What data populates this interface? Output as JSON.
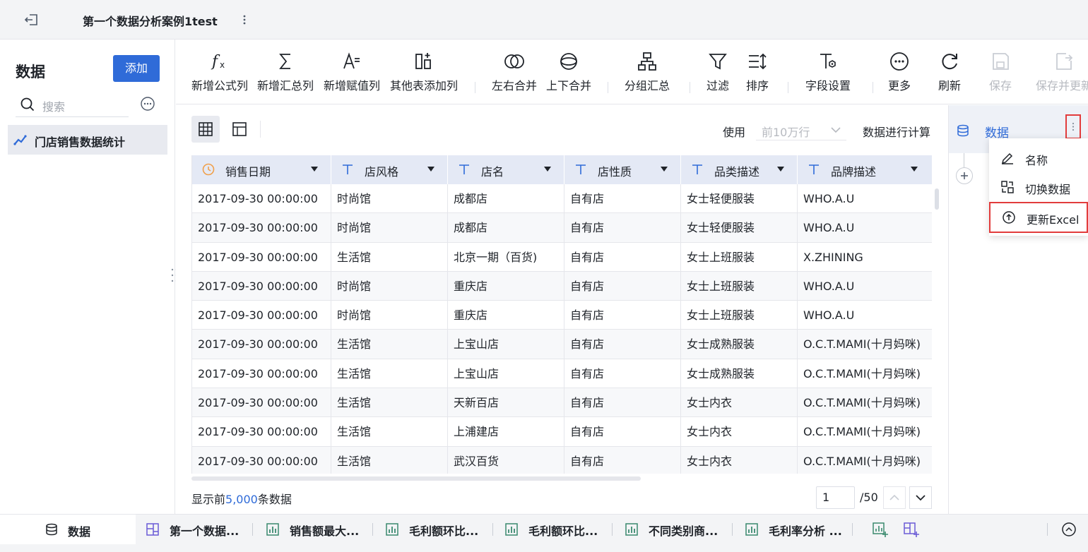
{
  "topbar": {
    "title": "第一个数据分析案例1test"
  },
  "left": {
    "title": "数据",
    "add_label": "添加",
    "search_placeholder": "搜索",
    "item_label": "门店销售数据统计"
  },
  "toolbar": {
    "items": [
      {
        "label": "新增公式列",
        "icon": "formula-icon"
      },
      {
        "label": "新增汇总列",
        "icon": "sigma-icon"
      },
      {
        "label": "新增赋值列",
        "icon": "assign-column-icon"
      },
      {
        "label": "其他表添加列",
        "icon": "add-column-icon"
      },
      {
        "label": "左右合并",
        "icon": "merge-horizontal-icon"
      },
      {
        "label": "上下合并",
        "icon": "merge-vertical-icon"
      },
      {
        "label": "分组汇总",
        "icon": "group-summary-icon"
      },
      {
        "label": "过滤",
        "icon": "filter-icon"
      },
      {
        "label": "排序",
        "icon": "sort-icon"
      },
      {
        "label": "字段设置",
        "icon": "field-settings-icon"
      },
      {
        "label": "更多",
        "icon": "more-icon"
      },
      {
        "label": "刷新",
        "icon": "refresh-icon"
      },
      {
        "label": "保存",
        "icon": "save-icon",
        "disabled": true
      },
      {
        "label": "保存并更新",
        "icon": "save-update-icon",
        "disabled": true
      }
    ]
  },
  "main": {
    "use_label": "使用",
    "use_value": "前10万行",
    "calc_label": "数据进行计算",
    "columns": [
      {
        "label": "销售日期",
        "type": "date"
      },
      {
        "label": "店风格",
        "type": "text"
      },
      {
        "label": "店名",
        "type": "text"
      },
      {
        "label": "店性质",
        "type": "text"
      },
      {
        "label": "品类描述",
        "type": "text"
      },
      {
        "label": "品牌描述",
        "type": "text"
      }
    ],
    "rows": [
      [
        "2017-09-30 00:00:00",
        "时尚馆",
        "成都店",
        "自有店",
        "女士轻便服装",
        "WHO.A.U"
      ],
      [
        "2017-09-30 00:00:00",
        "时尚馆",
        "成都店",
        "自有店",
        "女士轻便服装",
        "WHO.A.U"
      ],
      [
        "2017-09-30 00:00:00",
        "生活馆",
        "北京一期（百货)",
        "自有店",
        "女士上班服装",
        "X.ZHINING"
      ],
      [
        "2017-09-30 00:00:00",
        "时尚馆",
        "重庆店",
        "自有店",
        "女士上班服装",
        "WHO.A.U"
      ],
      [
        "2017-09-30 00:00:00",
        "时尚馆",
        "重庆店",
        "自有店",
        "女士上班服装",
        "WHO.A.U"
      ],
      [
        "2017-09-30 00:00:00",
        "生活馆",
        "上宝山店",
        "自有店",
        "女士成熟服装",
        "O.C.T.MAMI(十月妈咪)"
      ],
      [
        "2017-09-30 00:00:00",
        "生活馆",
        "上宝山店",
        "自有店",
        "女士成熟服装",
        "O.C.T.MAMI(十月妈咪)"
      ],
      [
        "2017-09-30 00:00:00",
        "生活馆",
        "天新百店",
        "自有店",
        "女士内衣",
        "O.C.T.MAMI(十月妈咪)"
      ],
      [
        "2017-09-30 00:00:00",
        "生活馆",
        "上浦建店",
        "自有店",
        "女士内衣",
        "O.C.T.MAMI(十月妈咪)"
      ],
      [
        "2017-09-30 00:00:00",
        "生活馆",
        "武汉百货",
        "自有店",
        "女士内衣",
        "O.C.T.MAMI(十月妈咪)"
      ]
    ],
    "footer_prefix": "显示前",
    "footer_count": "5,000",
    "footer_suffix": "条数据",
    "page_current": "1",
    "page_total": "/50"
  },
  "right": {
    "node_label": "数据",
    "menu": [
      {
        "label": "名称",
        "icon": "edit-icon"
      },
      {
        "label": "切换数据",
        "icon": "switch-data-icon"
      },
      {
        "label": "更新Excel",
        "icon": "update-excel-icon",
        "highlighted": true
      }
    ]
  },
  "bottom": {
    "data_tab": "数据",
    "tabs": [
      {
        "label": "第一个数据...",
        "icon": "dashboard-icon"
      },
      {
        "label": "销售额最大...",
        "icon": "chart-icon"
      },
      {
        "label": "毛利额环比...",
        "icon": "chart-icon"
      },
      {
        "label": "毛利额环比...",
        "icon": "chart-icon"
      },
      {
        "label": "不同类别商...",
        "icon": "chart-icon"
      },
      {
        "label": "毛利率分析 ...",
        "icon": "chart-icon"
      }
    ]
  },
  "colors": {
    "accent": "#2f6bd8",
    "highlight": "#e23c3c",
    "header_bg": "#e4e9f5"
  }
}
